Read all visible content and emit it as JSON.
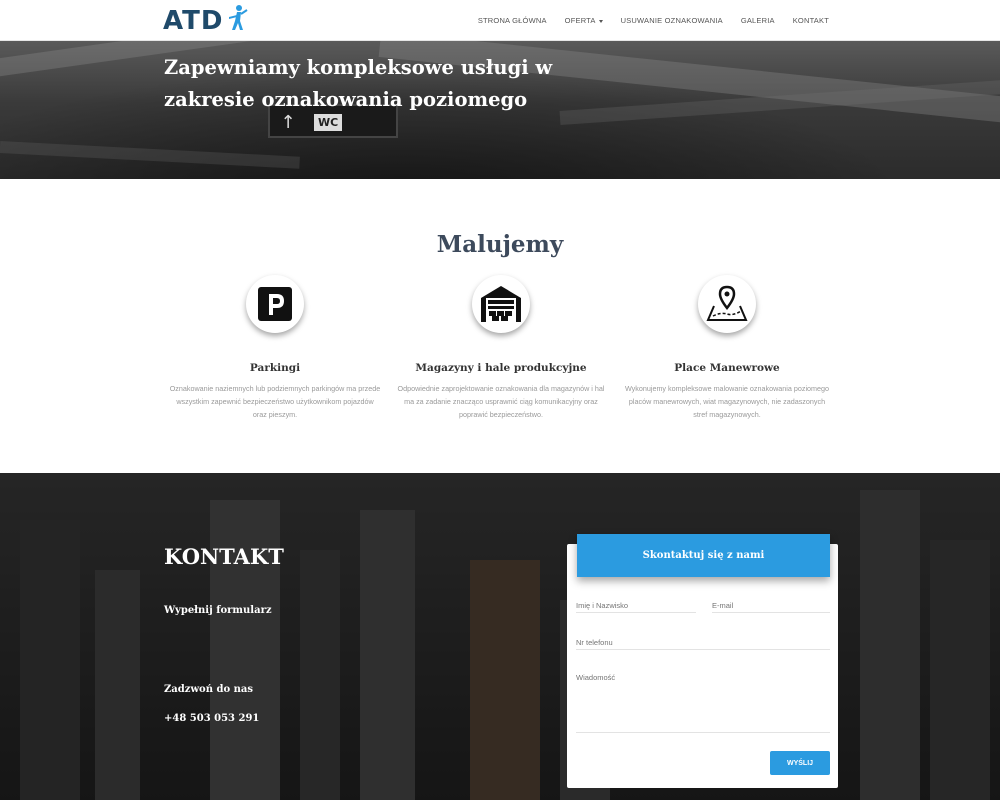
{
  "brand": {
    "logo_text": "ATD"
  },
  "nav": {
    "items": [
      {
        "label": "STRONA GŁÓWNA"
      },
      {
        "label": "OFERTA"
      },
      {
        "label": "USUWANIE OZNAKOWANIA"
      },
      {
        "label": "GALERIA"
      },
      {
        "label": "KONTAKT"
      }
    ]
  },
  "hero": {
    "title_line1": "Zapewniamy kompleksowe usługi w",
    "title_line2": "zakresie oznakowania poziomego",
    "sign_text": "WC"
  },
  "services": {
    "title": "Malujemy",
    "items": [
      {
        "name": "Parkingi",
        "icon": "parking-icon",
        "description": "Oznakowanie naziemnych lub podziemnych parkingów ma przede wszystkim zapewnić bezpieczeństwo użytkownikom pojazdów oraz pieszym."
      },
      {
        "name": "Magazyny i hale produkcyjne",
        "icon": "warehouse-icon",
        "description": "Odpowiednie zaprojektowanie oznakowania dla magazynów i hal ma za zadanie znacząco usprawnić ciąg komunikacyjny oraz poprawić bezpieczeństwo."
      },
      {
        "name": "Place Manewrowe",
        "icon": "map-pin-icon",
        "description": "Wykonujemy kompleksowe malowanie oznakowania poziomego placów manewrowych, wiat magazynowych, nie zadaszonych stref magazynowych."
      }
    ]
  },
  "contact": {
    "title": "KONTAKT",
    "fill_form": "Wypełnij formularz",
    "call_us": "Zadzwoń do nas",
    "phone": "+48 503 053 291",
    "form": {
      "header": "Skontaktuj się z nami",
      "name_label": "Imię i Nazwisko",
      "email_label": "E-mail",
      "phone_label": "Nr telefonu",
      "message_label": "Wiadomość",
      "submit": "WYŚLIJ"
    }
  },
  "colors": {
    "accent": "#2b9be0",
    "logo": "#1f4a6a",
    "heading": "#3d4a5c"
  }
}
